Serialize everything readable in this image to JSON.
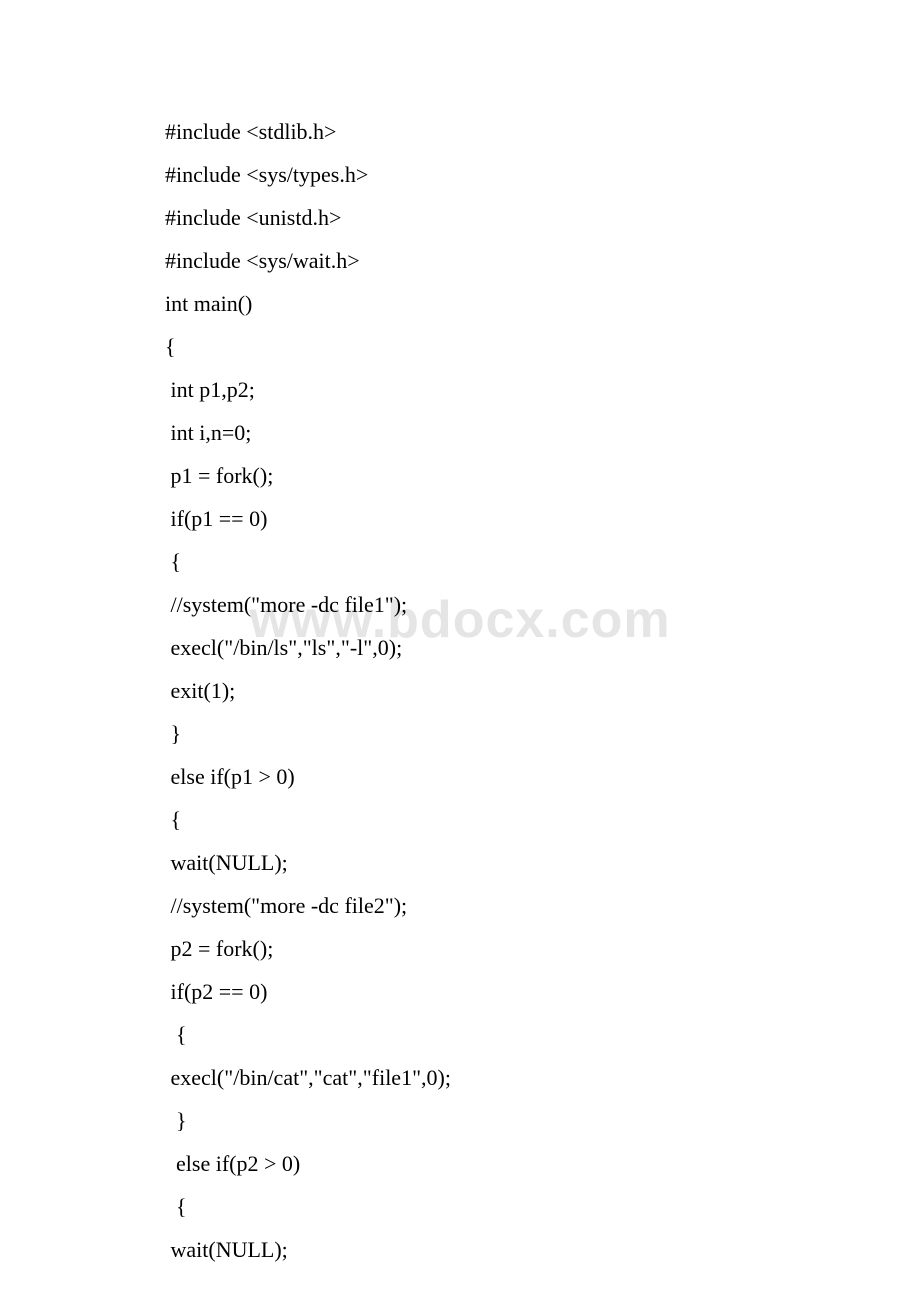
{
  "watermark": "www.bdocx.com",
  "code": {
    "lines": [
      "#include <stdlib.h>",
      "#include <sys/types.h>",
      "#include <unistd.h>",
      "#include <sys/wait.h>",
      "int main()",
      "{",
      " int p1,p2;",
      " int i,n=0;",
      " p1 = fork();",
      " if(p1 == 0)",
      " {",
      " //system(\"more -dc file1\");",
      " execl(\"/bin/ls\",\"ls\",\"-l\",0);",
      " exit(1);",
      " }",
      " else if(p1 > 0)",
      " {",
      " wait(NULL);",
      " //system(\"more -dc file2\");",
      " p2 = fork();",
      " if(p2 == 0)",
      "  {",
      " execl(\"/bin/cat\",\"cat\",\"file1\",0);",
      "  }",
      "  else if(p2 > 0)",
      "  {",
      " wait(NULL);"
    ]
  }
}
